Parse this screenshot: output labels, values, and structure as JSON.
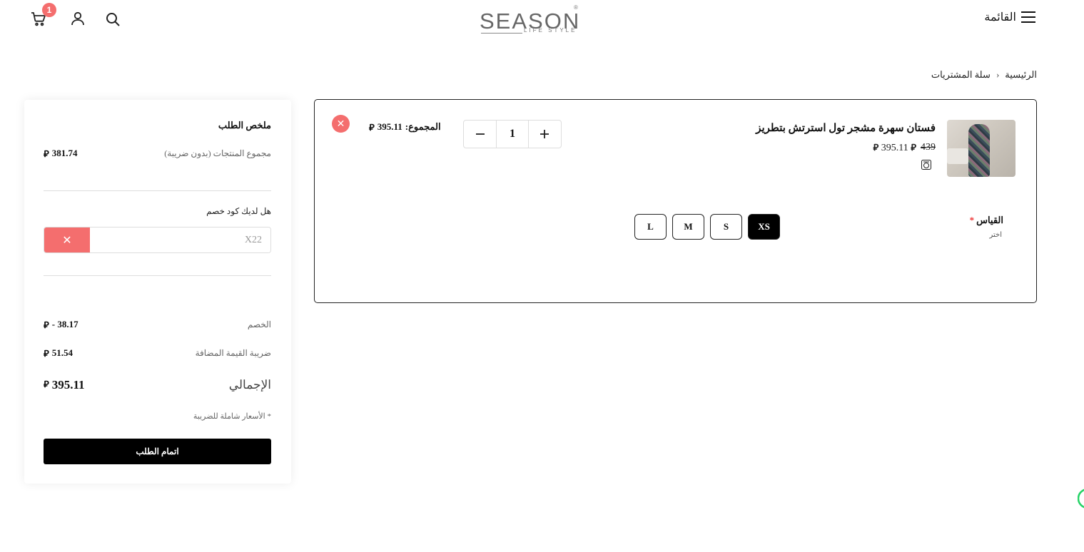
{
  "header": {
    "menu_label": "القائمة",
    "cart_count": "1",
    "logo_text": "SEASON",
    "logo_subtext": "LIFE STYLE",
    "logo_mark": "®"
  },
  "breadcrumb": {
    "home": "الرئيسية",
    "separator": "›",
    "current": "سلة المشتريات"
  },
  "cart_item": {
    "name": "فستان سهرة مشجر تول استرتش بتطريز",
    "old_price": "439",
    "price": "395.11",
    "currency_symbol": "⃁",
    "quantity": "1",
    "total_label": "المجموع:",
    "total_value": "395.11",
    "size_label": "القياس",
    "size_required_mark": "*",
    "size_hint": "اختر",
    "sizes": [
      "L",
      "M",
      "S",
      "XS"
    ],
    "selected_size": "XS",
    "remove_icon": "close-icon"
  },
  "summary": {
    "title": "ملخص الطلب",
    "subtotal_label": "مجموع المنتجات (بدون ضريبة)",
    "subtotal_value": "381.74",
    "coupon_question": "هل لديك كود خصم",
    "coupon_value": "X22",
    "discount_label": "الخصم",
    "discount_value": "38.17 -",
    "vat_label": "ضريبة القيمة المضافة",
    "vat_value": "51.54",
    "total_label": "الإجمالي",
    "total_value": "395.11",
    "tax_note": "* الأسعار شاملة للضريبة",
    "checkout_label": "اتمام الطلب"
  },
  "colors": {
    "accent_red": "#f46e6e",
    "primary_black": "#000000"
  }
}
